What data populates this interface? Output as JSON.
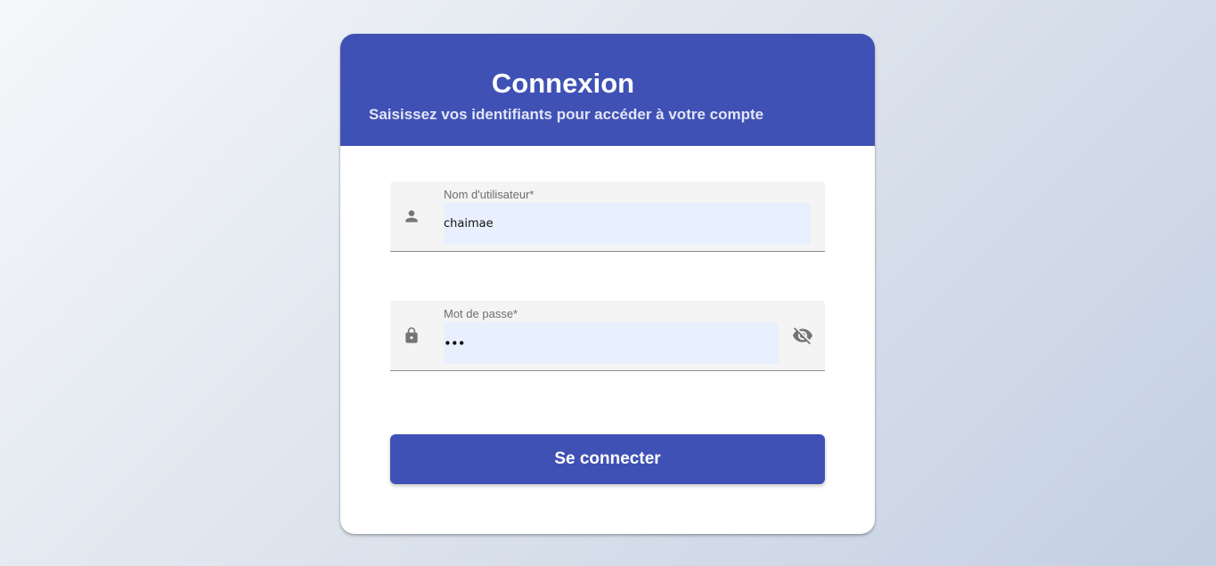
{
  "header": {
    "title": "Connexion",
    "subtitle": "Saisissez vos identifiants pour accéder à votre compte"
  },
  "form": {
    "username": {
      "label": "Nom d'utilisateur*",
      "value": "chaimae",
      "icon": "person-icon"
    },
    "password": {
      "label": "Mot de passe*",
      "value": "•••",
      "icon": "lock-icon",
      "toggle_icon": "eye-off-icon"
    },
    "submit_label": "Se connecter"
  },
  "colors": {
    "primary": "#3f51b5",
    "field_background": "#f4f4f4",
    "autofill_background": "#e8f0fe",
    "icon_gray": "#757575"
  }
}
